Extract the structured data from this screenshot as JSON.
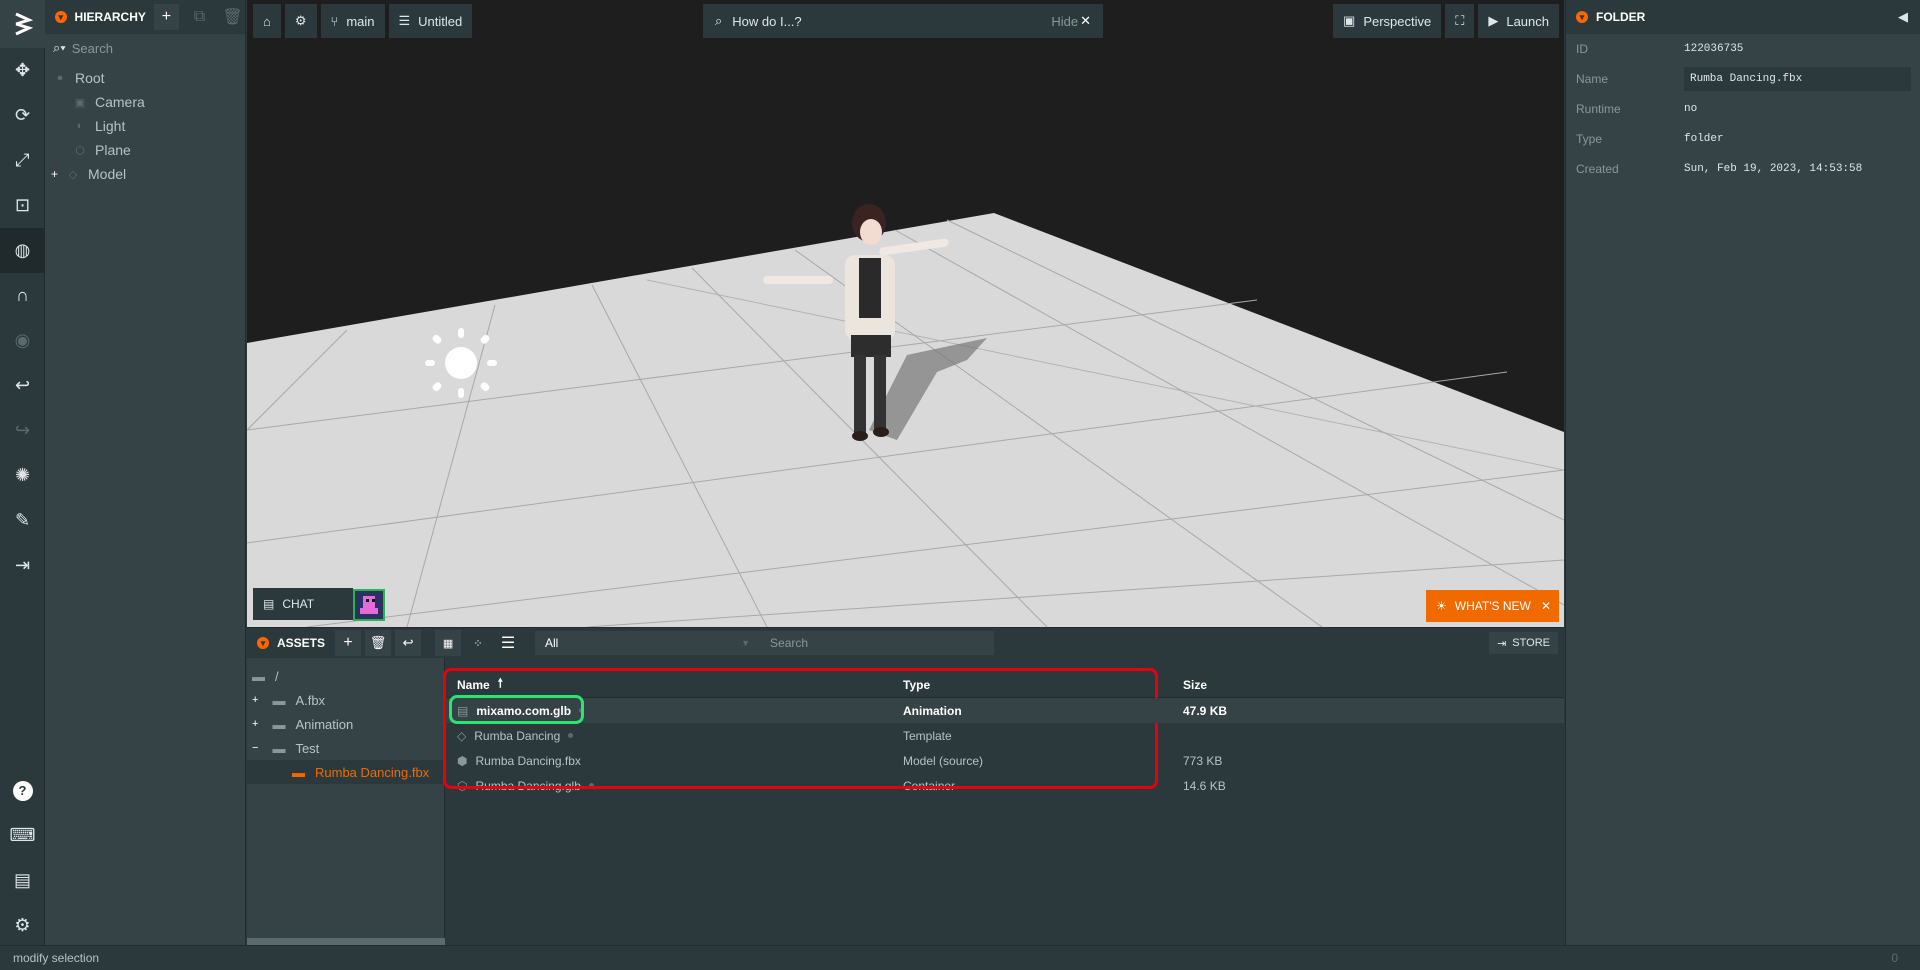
{
  "hierarchy": {
    "title": "HIERARCHY",
    "search_placeholder": "Search",
    "items": [
      {
        "label": "Root"
      },
      {
        "label": "Camera"
      },
      {
        "label": "Light"
      },
      {
        "label": "Plane"
      },
      {
        "label": "Model"
      }
    ]
  },
  "viewport": {
    "branch": "main",
    "scene_name": "Untitled",
    "help_placeholder": "How do I...?",
    "help_hide": "Hide",
    "camera_mode": "Perspective",
    "launch_label": "Launch",
    "chat_label": "CHAT",
    "whats_new_label": "WHAT'S NEW"
  },
  "inspector": {
    "title": "FOLDER",
    "props": [
      {
        "key": "ID",
        "value": "122036735"
      },
      {
        "key": "Name",
        "value": "Rumba Dancing.fbx"
      },
      {
        "key": "Runtime",
        "value": "no"
      },
      {
        "key": "Type",
        "value": "folder"
      },
      {
        "key": "Created",
        "value": "Sun, Feb 19, 2023, 14:53:58"
      }
    ]
  },
  "assets": {
    "title": "ASSETS",
    "filter_selected": "All",
    "search_placeholder": "Search",
    "store_label": "STORE",
    "tree": [
      {
        "label": "/"
      },
      {
        "label": "A.fbx"
      },
      {
        "label": "Animation"
      },
      {
        "label": "Test"
      },
      {
        "label": "Rumba Dancing.fbx"
      }
    ],
    "columns": {
      "name": "Name",
      "type": "Type",
      "size": "Size"
    },
    "rows": [
      {
        "name": "mixamo.com.glb",
        "type": "Animation",
        "size": "47.9 KB"
      },
      {
        "name": "Rumba Dancing",
        "type": "Template",
        "size": ""
      },
      {
        "name": "Rumba Dancing.fbx",
        "type": "Model (source)",
        "size": "773 KB"
      },
      {
        "name": "Rumba Dancing.glb",
        "type": "Container",
        "size": "14.6 KB"
      }
    ]
  },
  "statusbar": {
    "message": "modify selection",
    "count": "0"
  },
  "colors": {
    "accent": "#f06a00",
    "selection_green": "#2ae66c",
    "highlight_red": "#e8000f"
  }
}
